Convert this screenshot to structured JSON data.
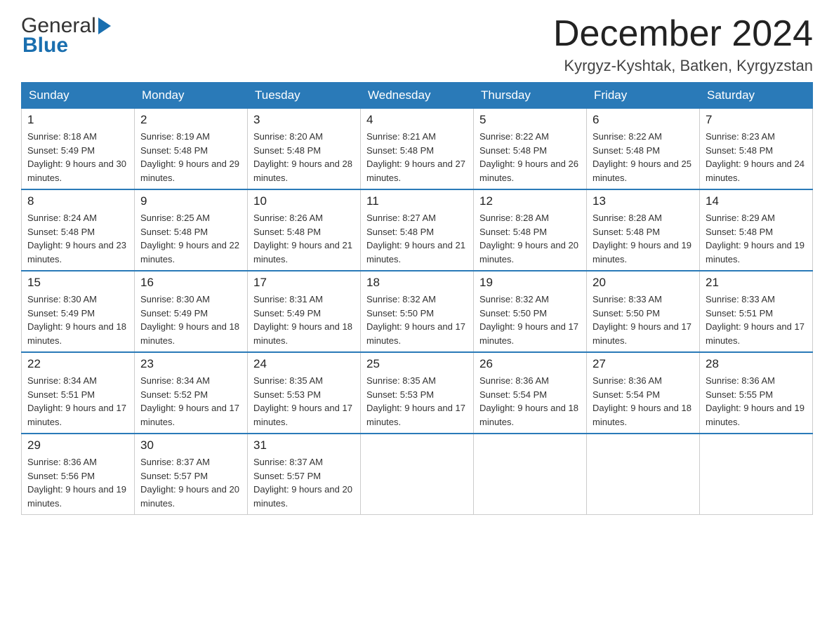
{
  "header": {
    "logo_general": "General",
    "logo_blue": "Blue",
    "month_title": "December 2024",
    "location": "Kyrgyz-Kyshtak, Batken, Kyrgyzstan"
  },
  "days_of_week": [
    "Sunday",
    "Monday",
    "Tuesday",
    "Wednesday",
    "Thursday",
    "Friday",
    "Saturday"
  ],
  "weeks": [
    [
      {
        "day": "1",
        "sunrise": "8:18 AM",
        "sunset": "5:49 PM",
        "daylight": "9 hours and 30 minutes."
      },
      {
        "day": "2",
        "sunrise": "8:19 AM",
        "sunset": "5:48 PM",
        "daylight": "9 hours and 29 minutes."
      },
      {
        "day": "3",
        "sunrise": "8:20 AM",
        "sunset": "5:48 PM",
        "daylight": "9 hours and 28 minutes."
      },
      {
        "day": "4",
        "sunrise": "8:21 AM",
        "sunset": "5:48 PM",
        "daylight": "9 hours and 27 minutes."
      },
      {
        "day": "5",
        "sunrise": "8:22 AM",
        "sunset": "5:48 PM",
        "daylight": "9 hours and 26 minutes."
      },
      {
        "day": "6",
        "sunrise": "8:22 AM",
        "sunset": "5:48 PM",
        "daylight": "9 hours and 25 minutes."
      },
      {
        "day": "7",
        "sunrise": "8:23 AM",
        "sunset": "5:48 PM",
        "daylight": "9 hours and 24 minutes."
      }
    ],
    [
      {
        "day": "8",
        "sunrise": "8:24 AM",
        "sunset": "5:48 PM",
        "daylight": "9 hours and 23 minutes."
      },
      {
        "day": "9",
        "sunrise": "8:25 AM",
        "sunset": "5:48 PM",
        "daylight": "9 hours and 22 minutes."
      },
      {
        "day": "10",
        "sunrise": "8:26 AM",
        "sunset": "5:48 PM",
        "daylight": "9 hours and 21 minutes."
      },
      {
        "day": "11",
        "sunrise": "8:27 AM",
        "sunset": "5:48 PM",
        "daylight": "9 hours and 21 minutes."
      },
      {
        "day": "12",
        "sunrise": "8:28 AM",
        "sunset": "5:48 PM",
        "daylight": "9 hours and 20 minutes."
      },
      {
        "day": "13",
        "sunrise": "8:28 AM",
        "sunset": "5:48 PM",
        "daylight": "9 hours and 19 minutes."
      },
      {
        "day": "14",
        "sunrise": "8:29 AM",
        "sunset": "5:48 PM",
        "daylight": "9 hours and 19 minutes."
      }
    ],
    [
      {
        "day": "15",
        "sunrise": "8:30 AM",
        "sunset": "5:49 PM",
        "daylight": "9 hours and 18 minutes."
      },
      {
        "day": "16",
        "sunrise": "8:30 AM",
        "sunset": "5:49 PM",
        "daylight": "9 hours and 18 minutes."
      },
      {
        "day": "17",
        "sunrise": "8:31 AM",
        "sunset": "5:49 PM",
        "daylight": "9 hours and 18 minutes."
      },
      {
        "day": "18",
        "sunrise": "8:32 AM",
        "sunset": "5:50 PM",
        "daylight": "9 hours and 17 minutes."
      },
      {
        "day": "19",
        "sunrise": "8:32 AM",
        "sunset": "5:50 PM",
        "daylight": "9 hours and 17 minutes."
      },
      {
        "day": "20",
        "sunrise": "8:33 AM",
        "sunset": "5:50 PM",
        "daylight": "9 hours and 17 minutes."
      },
      {
        "day": "21",
        "sunrise": "8:33 AM",
        "sunset": "5:51 PM",
        "daylight": "9 hours and 17 minutes."
      }
    ],
    [
      {
        "day": "22",
        "sunrise": "8:34 AM",
        "sunset": "5:51 PM",
        "daylight": "9 hours and 17 minutes."
      },
      {
        "day": "23",
        "sunrise": "8:34 AM",
        "sunset": "5:52 PM",
        "daylight": "9 hours and 17 minutes."
      },
      {
        "day": "24",
        "sunrise": "8:35 AM",
        "sunset": "5:53 PM",
        "daylight": "9 hours and 17 minutes."
      },
      {
        "day": "25",
        "sunrise": "8:35 AM",
        "sunset": "5:53 PM",
        "daylight": "9 hours and 17 minutes."
      },
      {
        "day": "26",
        "sunrise": "8:36 AM",
        "sunset": "5:54 PM",
        "daylight": "9 hours and 18 minutes."
      },
      {
        "day": "27",
        "sunrise": "8:36 AM",
        "sunset": "5:54 PM",
        "daylight": "9 hours and 18 minutes."
      },
      {
        "day": "28",
        "sunrise": "8:36 AM",
        "sunset": "5:55 PM",
        "daylight": "9 hours and 19 minutes."
      }
    ],
    [
      {
        "day": "29",
        "sunrise": "8:36 AM",
        "sunset": "5:56 PM",
        "daylight": "9 hours and 19 minutes."
      },
      {
        "day": "30",
        "sunrise": "8:37 AM",
        "sunset": "5:57 PM",
        "daylight": "9 hours and 20 minutes."
      },
      {
        "day": "31",
        "sunrise": "8:37 AM",
        "sunset": "5:57 PM",
        "daylight": "9 hours and 20 minutes."
      },
      null,
      null,
      null,
      null
    ]
  ]
}
